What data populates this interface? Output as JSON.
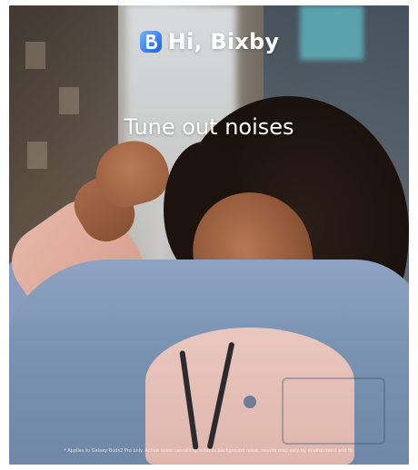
{
  "brand": {
    "text": "Hi, Bixby",
    "icon": "bixby-b-icon",
    "icon_color": "#2f7cff"
  },
  "headline": "Tune out noises",
  "disclaimer": "* Applies to Galaxy Buds2 Pro only. Active noise cancelling reduces background noise; results may vary by environment and fit."
}
